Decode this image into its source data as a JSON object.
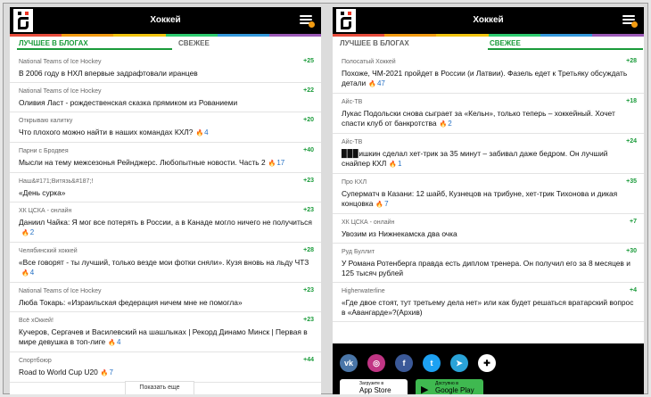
{
  "header": {
    "title": "Хоккей"
  },
  "colors": [
    "#e74c3c",
    "#f39c12",
    "#f1c40f",
    "#2ecc71",
    "#3498db",
    "#9b59b6"
  ],
  "tabs": {
    "best": "ЛУЧШЕЕ В БЛОГАХ",
    "fresh": "СВЕЖЕЕ"
  },
  "left": {
    "items": [
      {
        "source": "National Teams of Ice Hockey",
        "score": "+25",
        "title": "В 2006 году в НХЛ впервые задрафтовали иранцев",
        "count": ""
      },
      {
        "source": "National Teams of Ice Hockey",
        "score": "+22",
        "title": "Оливия Ласт - рождественская сказка прямиком из Рованиеми",
        "count": ""
      },
      {
        "source": "Открываю калитку",
        "score": "+20",
        "title": "Что плохого можно найти в наших командах КХЛ?",
        "count": "4"
      },
      {
        "source": "Парни с Бродвея",
        "score": "+40",
        "title": "Мысли на тему межсезонья Рейнджерс. Любопытные новости. Часть 2",
        "count": "17"
      },
      {
        "source": "Наш&#171;Витязь&#187;!",
        "score": "+23",
        "title": "«День сурка»",
        "count": ""
      },
      {
        "source": "ХК ЦСКА - онлайн",
        "score": "+23",
        "title": "Даниил Чайка: Я мог все потерять в России, а в Канаде могло ничего не получиться",
        "count": "2"
      },
      {
        "source": "Челябинский хоккей",
        "score": "+28",
        "title": "«Все говорят - ты лучший, только везде мои фотки сняли». Кузя вновь на льду ЧТЗ",
        "count": "4"
      },
      {
        "source": "National Teams of Ice Hockey",
        "score": "+23",
        "title": "Люба Токарь: «Израильская федерация ничем мне не помогла»",
        "count": ""
      },
      {
        "source": "Всё хОккей!",
        "score": "+23",
        "title": "Кучеров, Сергачев и Василевский на шашлыках | Рекорд Динамо Минск | Первая в мире девушка в топ-лиге",
        "count": "4"
      },
      {
        "source": "Спортбоюр",
        "score": "+44",
        "title": "Road to World Cup U20",
        "count": "7"
      }
    ],
    "more": "Показать еще"
  },
  "right": {
    "items": [
      {
        "source": "Полосатый Хоккей",
        "score": "+28",
        "title": "Похоже, ЧМ-2021 пройдет в России (и Латвии). Фазель едет к Третьяку обсуждать детали",
        "count": "47"
      },
      {
        "source": "Айс-ТВ",
        "score": "+18",
        "title": "Лукас Подольски снова сыграет за «Кельн», только теперь – хоккейный. Хочет спасти клуб от банкротства",
        "count": "2"
      },
      {
        "source": "Айс-ТВ",
        "score": "+24",
        "title": "▉▉▉ишкин сделал хет-трик за 35 минут – забивал даже бедром. Он лучший снайпер КХЛ",
        "count": "1"
      },
      {
        "source": "Про КХЛ",
        "score": "+35",
        "title": "Суперматч в Казани: 12 шайб, Кузнецов на трибуне, хет-трик Тихонова и дикая концовка",
        "count": "7"
      },
      {
        "source": "ХК ЦСКА - онлайн",
        "score": "+7",
        "title": "Увозим из Нижнекамска два очка",
        "count": ""
      },
      {
        "source": "Руд Буллит",
        "score": "+30",
        "title": "У Романа Ротенберга правда есть диплом тренера. Он получил его за 8 месяцев и 125 тысяч рублей",
        "count": ""
      },
      {
        "source": "Higherwaterline",
        "score": "+4",
        "title": "«Где двое стоят, тут третьему дела нет» или как будет решаться вратарский вопрос в «Авангарде»?(Архив)",
        "count": ""
      }
    ]
  },
  "footer": {
    "social": [
      "vk",
      "instagram",
      "facebook",
      "twitter",
      "telegram",
      "sports"
    ],
    "appstore_small": "Загрузите в",
    "appstore": "App Store",
    "gplay_small": "Доступно в",
    "gplay": "Google Play"
  }
}
